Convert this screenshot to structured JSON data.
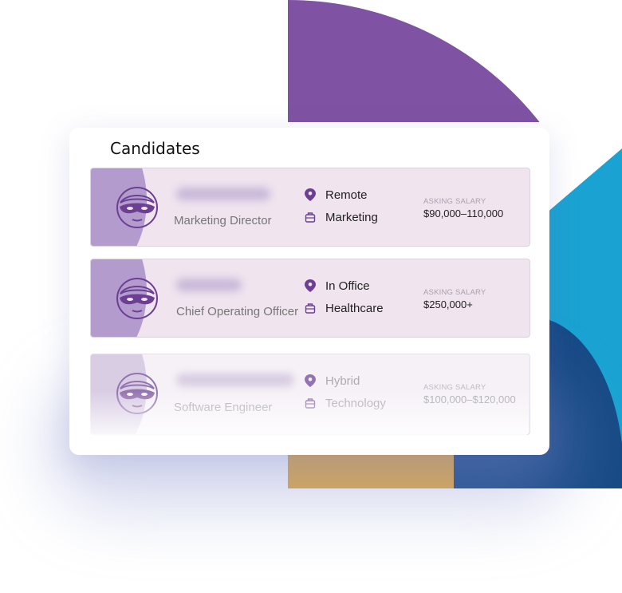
{
  "panel": {
    "title": "Candidates"
  },
  "candidates": [
    {
      "role": "Marketing Director",
      "location": "Remote",
      "industry": "Marketing",
      "salary_label": "ASKING SALARY",
      "salary": "$90,000–110,000"
    },
    {
      "role": "Chief Operating Officer",
      "location": "In Office",
      "industry": "Healthcare",
      "salary_label": "ASKING SALARY",
      "salary": "$250,000+"
    },
    {
      "role": "Software Engineer",
      "location": "Hybrid",
      "industry": "Technology",
      "salary_label": "ASKING SALARY",
      "salary": "$100,000–$120,000"
    }
  ],
  "icons": {
    "location": "map-pin-icon",
    "industry": "briefcase-icon",
    "avatar": "masked-person-icon"
  },
  "colors": {
    "accent_purple": "#7f52a3",
    "row_background": "#f0e4ef",
    "deco_teal": "#1aa3d2",
    "deco_navy": "#174a86",
    "deco_yellow": "#e3aa40"
  }
}
